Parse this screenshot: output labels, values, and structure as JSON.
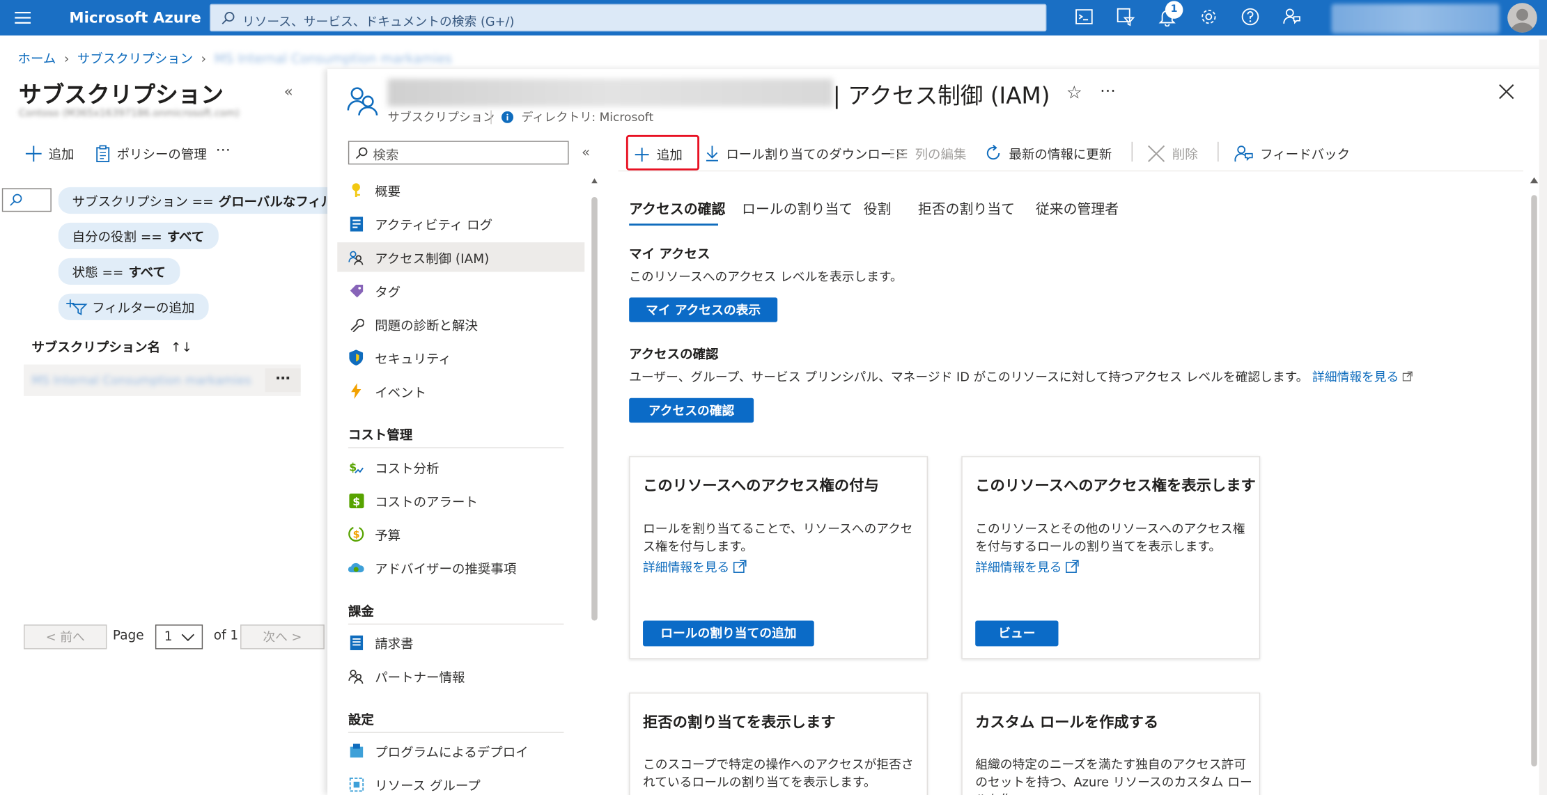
{
  "topbar": {
    "brand": "Microsoft Azure",
    "search_placeholder": "リソース、サービス、ドキュメントの検索 (G+/)",
    "notification_count": "1",
    "accent": "#1a6fc4"
  },
  "breadcrumb": {
    "home": "ホーム",
    "subscriptions": "サブスクリプション",
    "current": "MS Internal Consumption markamies"
  },
  "left_pane": {
    "title": "サブスクリプション",
    "subtitle": "Contoso (M365x16397186.onmicrosoft.com)",
    "add_label": "追加",
    "policy_label": "ポリシーの管理",
    "more": "⋯",
    "filters": [
      {
        "key": "サブスクリプション ==",
        "value": "グローバルなフィルター"
      },
      {
        "key": "自分の役割 ==",
        "value": "すべて"
      },
      {
        "key": "状態 ==",
        "value": "すべて"
      }
    ],
    "add_filter_label": "フィルターの追加",
    "column_header": "サブスクリプション名",
    "sort_icon": "↑↓",
    "rows": [
      {
        "name": "MS Internal Consumption markamies"
      }
    ],
    "row_more": "⋯",
    "pager": {
      "prev": "< 前へ",
      "page_label": "Page",
      "page_value": "1",
      "of_label": "of 1",
      "next": "次へ >"
    }
  },
  "resource": {
    "title_suffix": "| アクセス制御 (IAM)",
    "type_label": "サブスクリプション",
    "directory_label": "ディレクトリ: Microsoft",
    "star": "☆",
    "more": "⋯"
  },
  "menu": {
    "search_placeholder": "検索",
    "items": [
      {
        "label": "概要",
        "icon": "key-icon"
      },
      {
        "label": "アクティビティ ログ",
        "icon": "log-icon"
      },
      {
        "label": "アクセス制御 (IAM)",
        "icon": "people-icon"
      },
      {
        "label": "タグ",
        "icon": "tag-icon"
      },
      {
        "label": "問題の診断と解決",
        "icon": "wrench-icon"
      },
      {
        "label": "セキュリティ",
        "icon": "shield-icon"
      },
      {
        "label": "イベント",
        "icon": "lightning-icon"
      }
    ],
    "section_cost": "コスト管理",
    "cost_items": [
      {
        "label": "コスト分析",
        "icon": "cost-analysis-icon"
      },
      {
        "label": "コストのアラート",
        "icon": "cost-alert-icon"
      },
      {
        "label": "予算",
        "icon": "budget-icon"
      },
      {
        "label": "アドバイザーの推奨事項",
        "icon": "advisor-icon"
      }
    ],
    "section_billing": "課金",
    "billing_items": [
      {
        "label": "請求書",
        "icon": "invoice-icon"
      },
      {
        "label": "パートナー情報",
        "icon": "partner-icon"
      }
    ],
    "section_settings": "設定",
    "settings_items": [
      {
        "label": "プログラムによるデプロイ",
        "icon": "deploy-icon"
      },
      {
        "label": "リソース グループ",
        "icon": "resource-group-icon"
      }
    ]
  },
  "toolbar": {
    "add": "追加",
    "download": "ロール割り当てのダウンロード",
    "edit_columns": "列の編集",
    "refresh": "最新の情報に更新",
    "delete": "削除",
    "feedback": "フィードバック"
  },
  "tabs": [
    "アクセスの確認",
    "ロールの割り当て",
    "役割",
    "拒否の割り当て",
    "従来の管理者"
  ],
  "my_access": {
    "title": "マイ アクセス",
    "desc": "このリソースへのアクセス レベルを表示します。",
    "button": "マイ アクセスの表示"
  },
  "check_access": {
    "title": "アクセスの確認",
    "desc": "ユーザー、グループ、サービス プリンシパル、マネージド ID がこのリソースに対して持つアクセス レベルを確認します。",
    "link": "詳細情報を見る",
    "button": "アクセスの確認"
  },
  "cards": [
    {
      "title": "このリソースへのアクセス権の付与",
      "desc": "ロールを割り当てることで、リソースへのアクセス権を付与します。",
      "link": "詳細情報を見る",
      "button": "ロールの割り当ての追加"
    },
    {
      "title": "このリソースへのアクセス権を表示します",
      "desc": "このリソースとその他のリソースへのアクセス権を付与するロールの割り当てを表示します。",
      "link": "詳細情報を見る",
      "button": "ビュー"
    },
    {
      "title": "拒否の割り当てを表示します",
      "desc": "このスコープで特定の操作へのアクセスが拒否されているロールの割り当てを表示します。"
    },
    {
      "title": "カスタム ロールを作成する",
      "desc": "組織の特定のニーズを満たす独自のアクセス許可のセットを持つ、Azure リソースのカスタム ロールを作"
    }
  ]
}
